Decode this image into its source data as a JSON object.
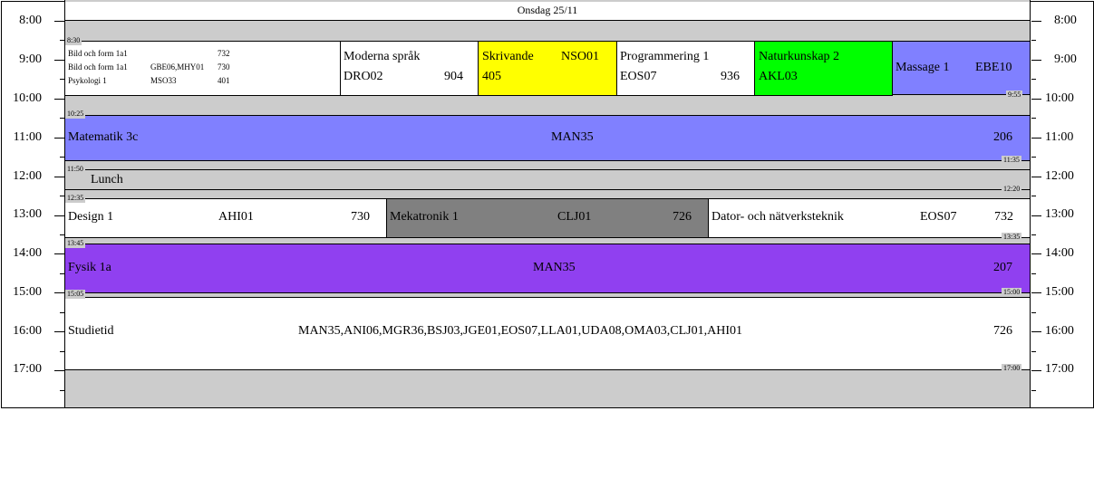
{
  "day_header": "Onsdag 25/11",
  "hours": [
    "8:00",
    "9:00",
    "10:00",
    "11:00",
    "12:00",
    "13:00",
    "14:00",
    "15:00",
    "16:00",
    "17:00"
  ],
  "colors": {
    "background": "#cccccc",
    "white": "#ffffff",
    "yellow": "#ffff00",
    "green": "#00ff00",
    "periwinkle": "#8080ff",
    "gray": "#808080",
    "purple": "#9040f0"
  },
  "events": {
    "morning_mixed": {
      "start_time": "8:30",
      "rows": [
        {
          "course": "Bild och form 1a1",
          "teacher": "",
          "room": "732"
        },
        {
          "course": "Bild och form 1a1",
          "teacher": "GBE06,MHY01",
          "room": "730"
        },
        {
          "course": "Psykologi 1",
          "teacher": "MSO33",
          "room": "401"
        }
      ]
    },
    "moderna": {
      "course": "Moderna språk",
      "teacher": "DRO02",
      "room": "904"
    },
    "skrivande": {
      "course": "Skrivande",
      "teacher": "NSO01",
      "room": "405"
    },
    "programmering": {
      "course": "Programmering 1",
      "teacher": "EOS07",
      "room": "936"
    },
    "naturkunskap": {
      "course": "Naturkunskap 2",
      "teacher": "AKL03"
    },
    "massage": {
      "course": "Massage 1",
      "teacher": "EBE10",
      "end_time": "9:55"
    },
    "matematik": {
      "course": "Matematik 3c",
      "teacher": "MAN35",
      "room": "206",
      "start_time": "10:25",
      "end_time": "11:35"
    },
    "lunch": {
      "course": "Lunch",
      "start_time": "11:50",
      "end_time": "12:20"
    },
    "design": {
      "course": "Design 1",
      "teacher": "AHI01",
      "room": "730",
      "start_time": "12:35"
    },
    "mekatronik": {
      "course": "Mekatronik 1",
      "teacher": "CLJ01",
      "room": "726"
    },
    "dator": {
      "course": "Dator- och nätverksteknik",
      "teacher": "EOS07",
      "room": "732",
      "end_time": "13:35"
    },
    "fysik": {
      "course": "Fysik 1a",
      "teacher": "MAN35",
      "room": "207",
      "start_time": "13:45",
      "end_time": "15:00"
    },
    "studietid": {
      "course": "Studietid",
      "teacher": "MAN35,ANI06,MGR36,BSJ03,JGE01,EOS07,LLA01,UDA08,OMA03,CLJ01,AHI01",
      "room": "726",
      "start_time": "15:05",
      "end_time": "17:00"
    }
  }
}
